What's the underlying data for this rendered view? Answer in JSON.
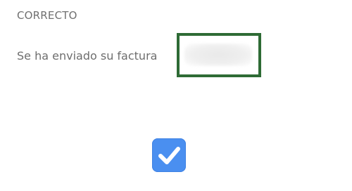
{
  "dialog": {
    "title": "CORRECTO",
    "message": "Se ha enviado su factura"
  },
  "checkbox": {
    "checked": true,
    "icon": "checkmark-icon",
    "color": "#4a8ff0"
  },
  "highlight": {
    "color": "#2e6b35"
  }
}
